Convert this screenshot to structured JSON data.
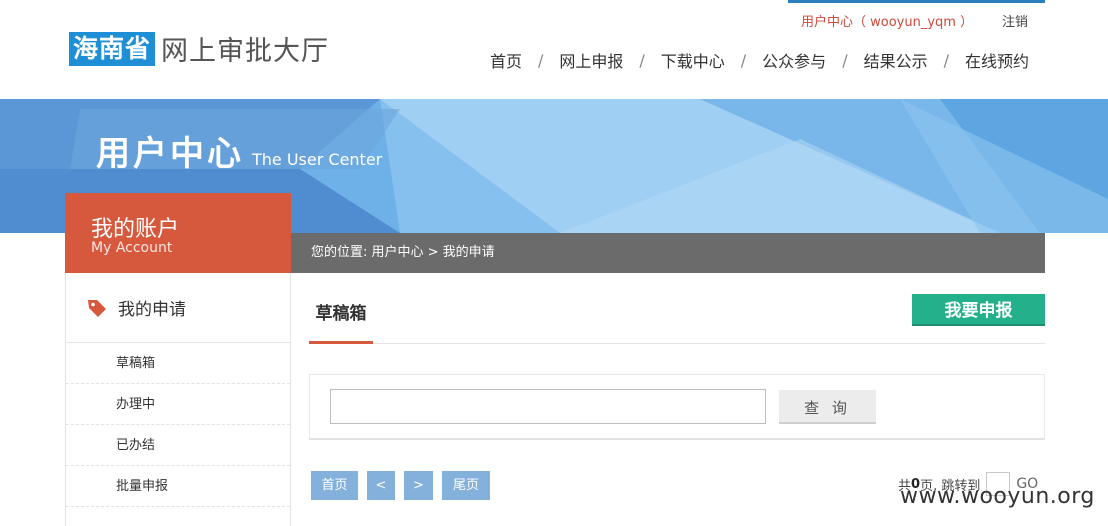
{
  "header": {
    "logo_box": "海南省",
    "logo_text": "网上审批大厅",
    "user_link": "用户中心（ wooyun_yqm ）",
    "logout": "注销",
    "nav": [
      "首页",
      "网上申报",
      "下载中心",
      "公众参与",
      "结果公示",
      "在线预约"
    ],
    "nav_separator": "/"
  },
  "banner": {
    "title_cn": "用户中心",
    "title_en": "The User Center"
  },
  "sidebar": {
    "account_cn": "我的账户",
    "account_en": "My Account",
    "section_label": "我的申请",
    "items": [
      "草稿箱",
      "办理中",
      "已办结",
      "批量申报"
    ]
  },
  "breadcrumb": "您的位置:  用户中心 > 我的申请",
  "content": {
    "active_tab": "草稿箱",
    "apply_button": "我要申报",
    "search": {
      "value": "",
      "button": "查 询"
    },
    "pager": {
      "first": "首页",
      "prev": "<",
      "next": ">",
      "last": "尾页",
      "total_prefix": "共",
      "total_pages": "0",
      "total_suffix": "页, 跳转到",
      "go": "GO"
    }
  },
  "watermark": "www.wooyun.org",
  "colors": {
    "brand_blue": "#1e8fd6",
    "accent_red": "#d6593d",
    "apply_green": "#23b08a",
    "pager_blue": "#84b0dc",
    "breadcrumb_gray": "#6b6b6b"
  }
}
